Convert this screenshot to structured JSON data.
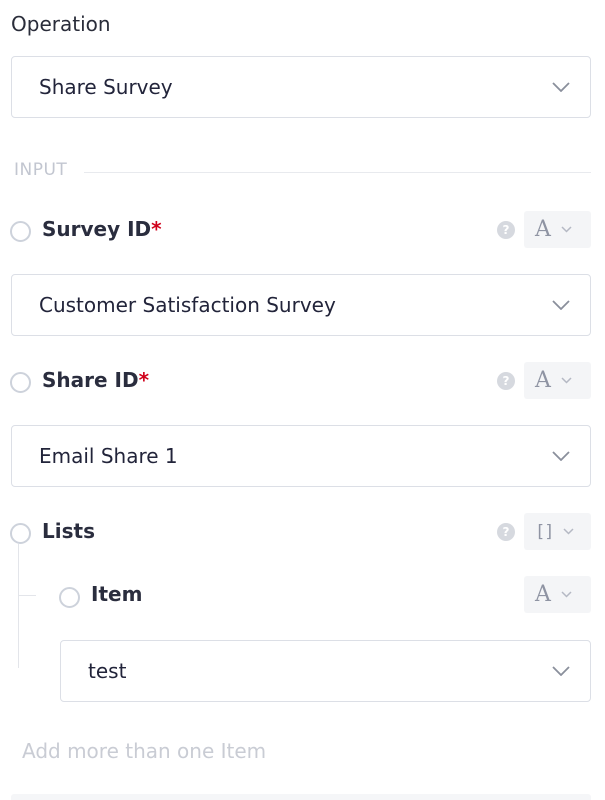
{
  "operation": {
    "label": "Operation",
    "value": "Share Survey"
  },
  "section": {
    "title": "INPUT"
  },
  "fields": {
    "survey_id": {
      "label": "Survey ID",
      "required_mark": "*",
      "type_glyph": "A",
      "value": "Customer Satisfaction Survey"
    },
    "share_id": {
      "label": "Share ID",
      "required_mark": "*",
      "type_glyph": "A",
      "value": "Email Share 1"
    },
    "lists": {
      "label": "Lists",
      "type_glyph": "[]",
      "item": {
        "label": "Item",
        "type_glyph": "A",
        "value": "test"
      },
      "add_more": "Add more than one Item"
    }
  },
  "icons": {
    "help": "question-circle-icon",
    "dropdown": "chevron-down-icon"
  },
  "colors": {
    "required": "#d0021b",
    "muted_text": "#c9ccd4",
    "border": "#dcdfe6"
  }
}
